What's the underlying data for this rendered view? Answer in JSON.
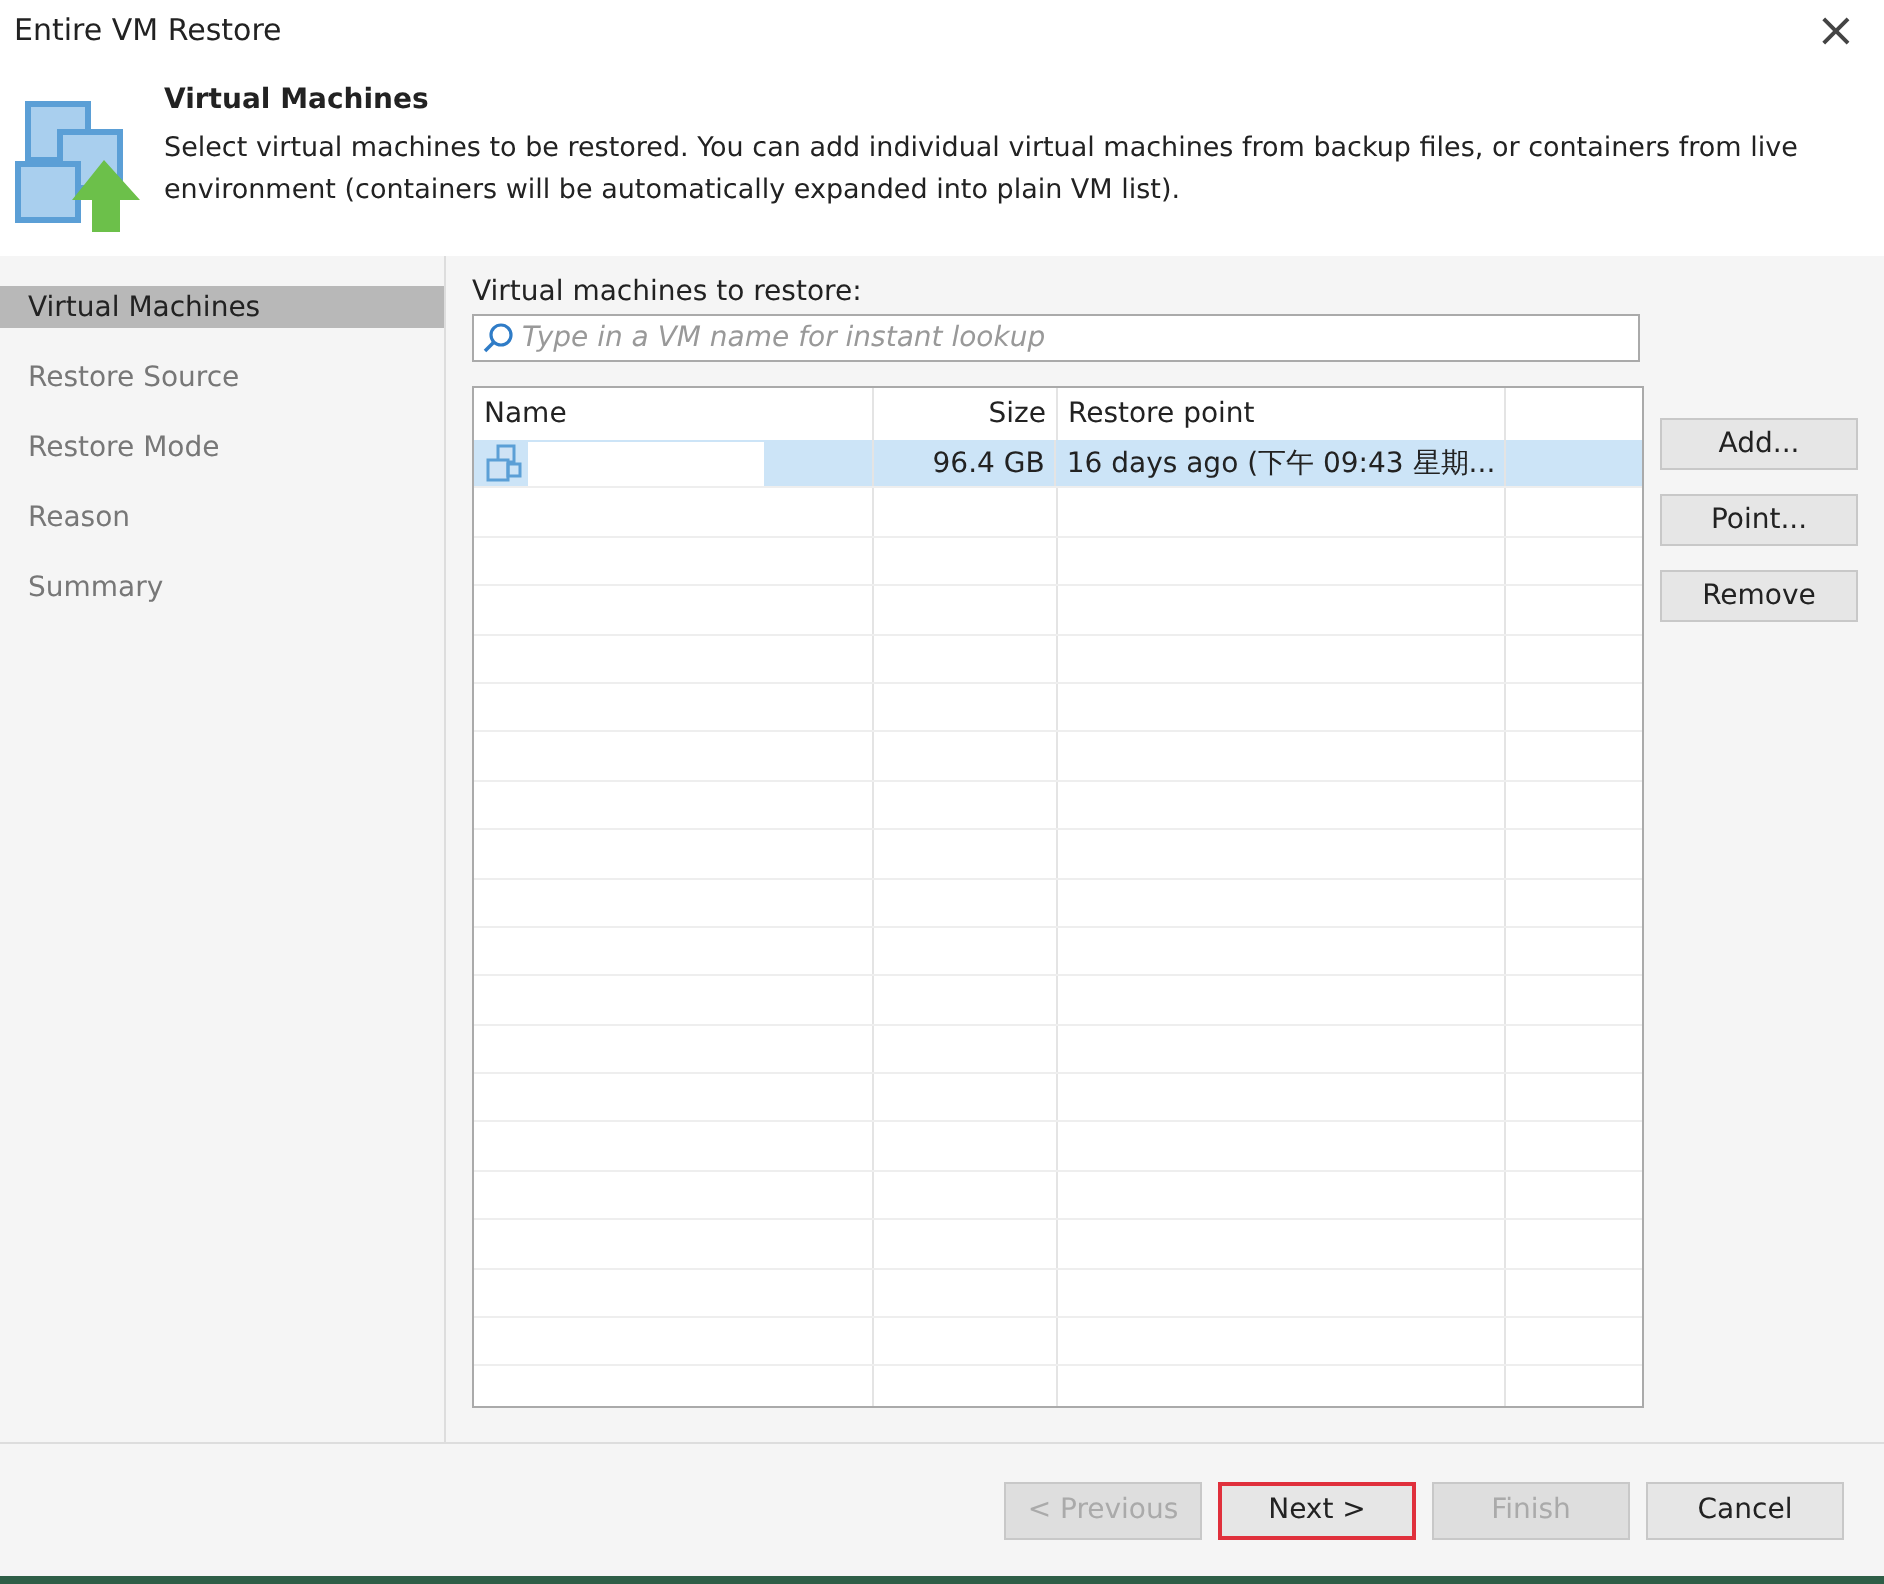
{
  "window": {
    "title": "Entire VM Restore",
    "close": "×"
  },
  "header": {
    "title": "Virtual Machines",
    "description": "Select virtual machines to be restored. You can add individual virtual machines from backup files, or containers from live environment (containers will be automatically expanded into plain VM list)."
  },
  "sidebar": {
    "items": [
      {
        "label": "Virtual Machines",
        "selected": true
      },
      {
        "label": "Restore Source",
        "selected": false
      },
      {
        "label": "Restore Mode",
        "selected": false
      },
      {
        "label": "Reason",
        "selected": false
      },
      {
        "label": "Summary",
        "selected": false
      }
    ]
  },
  "list_label": "Virtual machines to restore:",
  "search": {
    "placeholder": "Type in a VM name for instant lookup"
  },
  "table": {
    "columns": [
      "Name",
      "Size",
      "Restore point"
    ],
    "rows": [
      {
        "size": "96.4 GB",
        "restore_point": "16 days ago (下午 09:43 星期...",
        "selected": true
      }
    ]
  },
  "side_buttons": [
    "Add...",
    "Point...",
    "Remove"
  ],
  "footer_buttons": [
    {
      "label": "< Previous",
      "disabled": true,
      "highlighted": false
    },
    {
      "label": "Next >",
      "disabled": false,
      "highlighted": true
    },
    {
      "label": "Finish",
      "disabled": true,
      "highlighted": false
    },
    {
      "label": "Cancel",
      "disabled": false,
      "highlighted": false
    }
  ]
}
